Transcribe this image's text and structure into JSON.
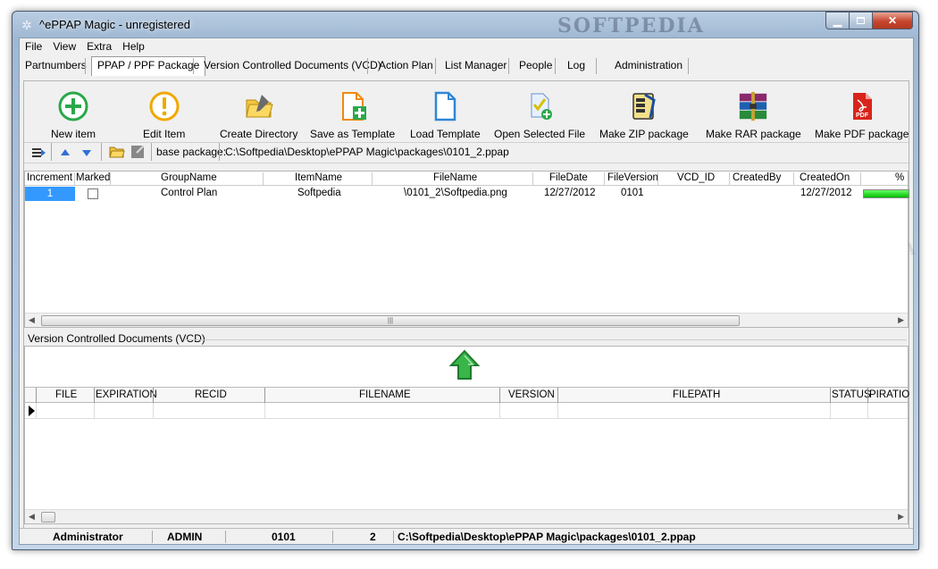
{
  "window": {
    "title": "^ePPAP Magic - unregistered",
    "watermark": "SOFTPEDIA"
  },
  "menu": [
    "File",
    "View",
    "Extra",
    "Help"
  ],
  "tabs": [
    "Partnumbers",
    "PPAP / PPF Package",
    "Version Controlled Documents (VCD)",
    "Action Plan",
    "List Manager",
    "People",
    "Log",
    "Administration"
  ],
  "toolbar": {
    "new_item": "New item",
    "edit_item": "Edit Item",
    "create_directory": "Create Directory",
    "save_as_template": "Save as Template",
    "load_template": "Load Template",
    "open_selected_file": "Open Selected File",
    "make_zip": "Make ZIP package",
    "make_rar": "Make RAR package",
    "make_pdf": "Make PDF package"
  },
  "base_package": {
    "label": "base package:",
    "value": "C:\\Softpedia\\Desktop\\ePPAP Magic\\packages\\0101_2.ppap"
  },
  "items_grid": {
    "columns": [
      "Increment",
      "Marked",
      "GroupName",
      "ItemName",
      "FileName",
      "FileDate",
      "FileVersion",
      "VCD_ID",
      "CreatedBy",
      "CreatedOn",
      "%"
    ],
    "rows": [
      {
        "increment": "1",
        "marked": false,
        "group": "Control Plan",
        "item": "Softpedia",
        "file": "\\0101_2\\Softpedia.png",
        "date": "12/27/2012",
        "version": "0101",
        "vcd_id": "",
        "created_by": "",
        "created_on": "12/27/2012",
        "percent": 100
      }
    ]
  },
  "vcd": {
    "title": "Version Controlled Documents (VCD)",
    "columns": [
      "FILE",
      "EXPIRATION",
      "RECID",
      "FILENAME",
      "VERSION",
      "FILEPATH",
      "STATUS",
      "PIRATIO"
    ]
  },
  "status": {
    "user": "Administrator",
    "role": "ADMIN",
    "partnumber": "0101",
    "revision": "2",
    "path": "C:\\Softpedia\\Desktop\\ePPAP Magic\\packages\\0101_2.ppap"
  },
  "colors": {
    "selected_row": "#3399ff",
    "progress": "#00bb00",
    "close_button": "#c7462e"
  },
  "icons": {
    "app": "gear-icon",
    "up": "green-up-arrow-icon"
  }
}
